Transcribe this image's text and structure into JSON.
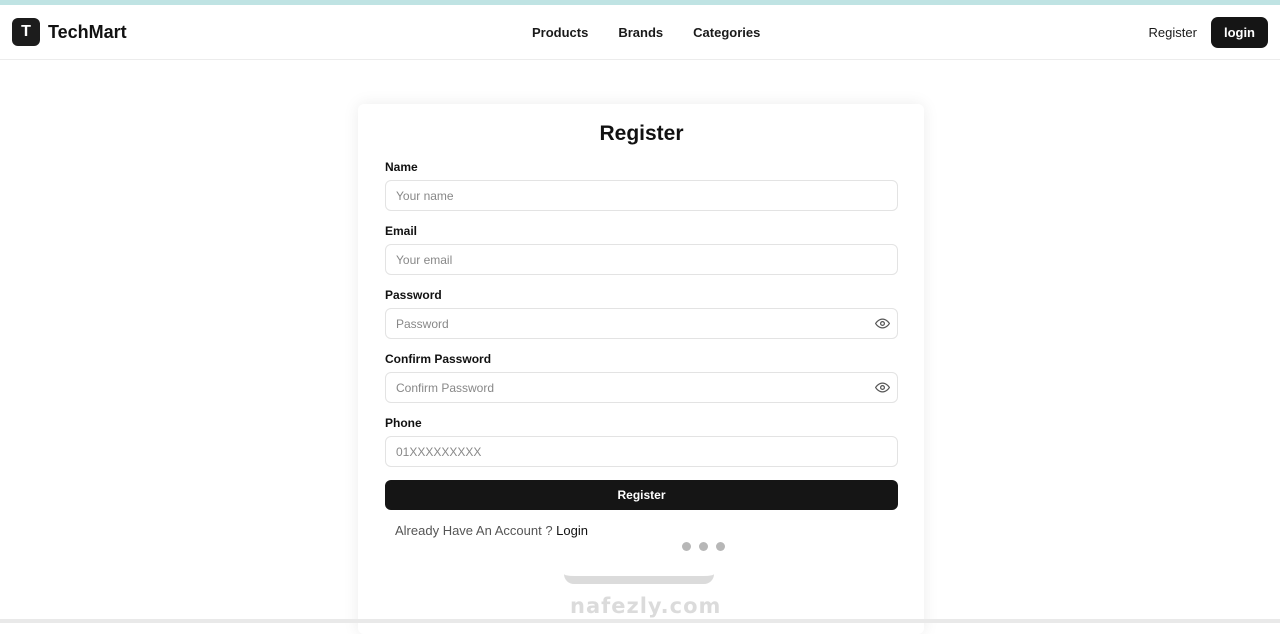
{
  "brand": {
    "logo_letter": "T",
    "name": "TechMart"
  },
  "nav": {
    "links": [
      "Products",
      "Brands",
      "Categories"
    ],
    "register_label": "Register",
    "login_label": "login"
  },
  "form": {
    "title": "Register",
    "fields": {
      "name": {
        "label": "Name",
        "placeholder": "Your name"
      },
      "email": {
        "label": "Email",
        "placeholder": "Your email"
      },
      "password": {
        "label": "Password",
        "placeholder": "Password"
      },
      "confirm_password": {
        "label": "Confirm Password",
        "placeholder": "Confirm Password"
      },
      "phone": {
        "label": "Phone",
        "placeholder": "01XXXXXXXXX"
      }
    },
    "submit_label": "Register",
    "already_text": "Already Have An Account ? ",
    "login_link": "Login"
  },
  "watermark": {
    "text": "nafezly.com"
  },
  "colors": {
    "primary": "#151515",
    "strip": "#bfe3e3"
  }
}
